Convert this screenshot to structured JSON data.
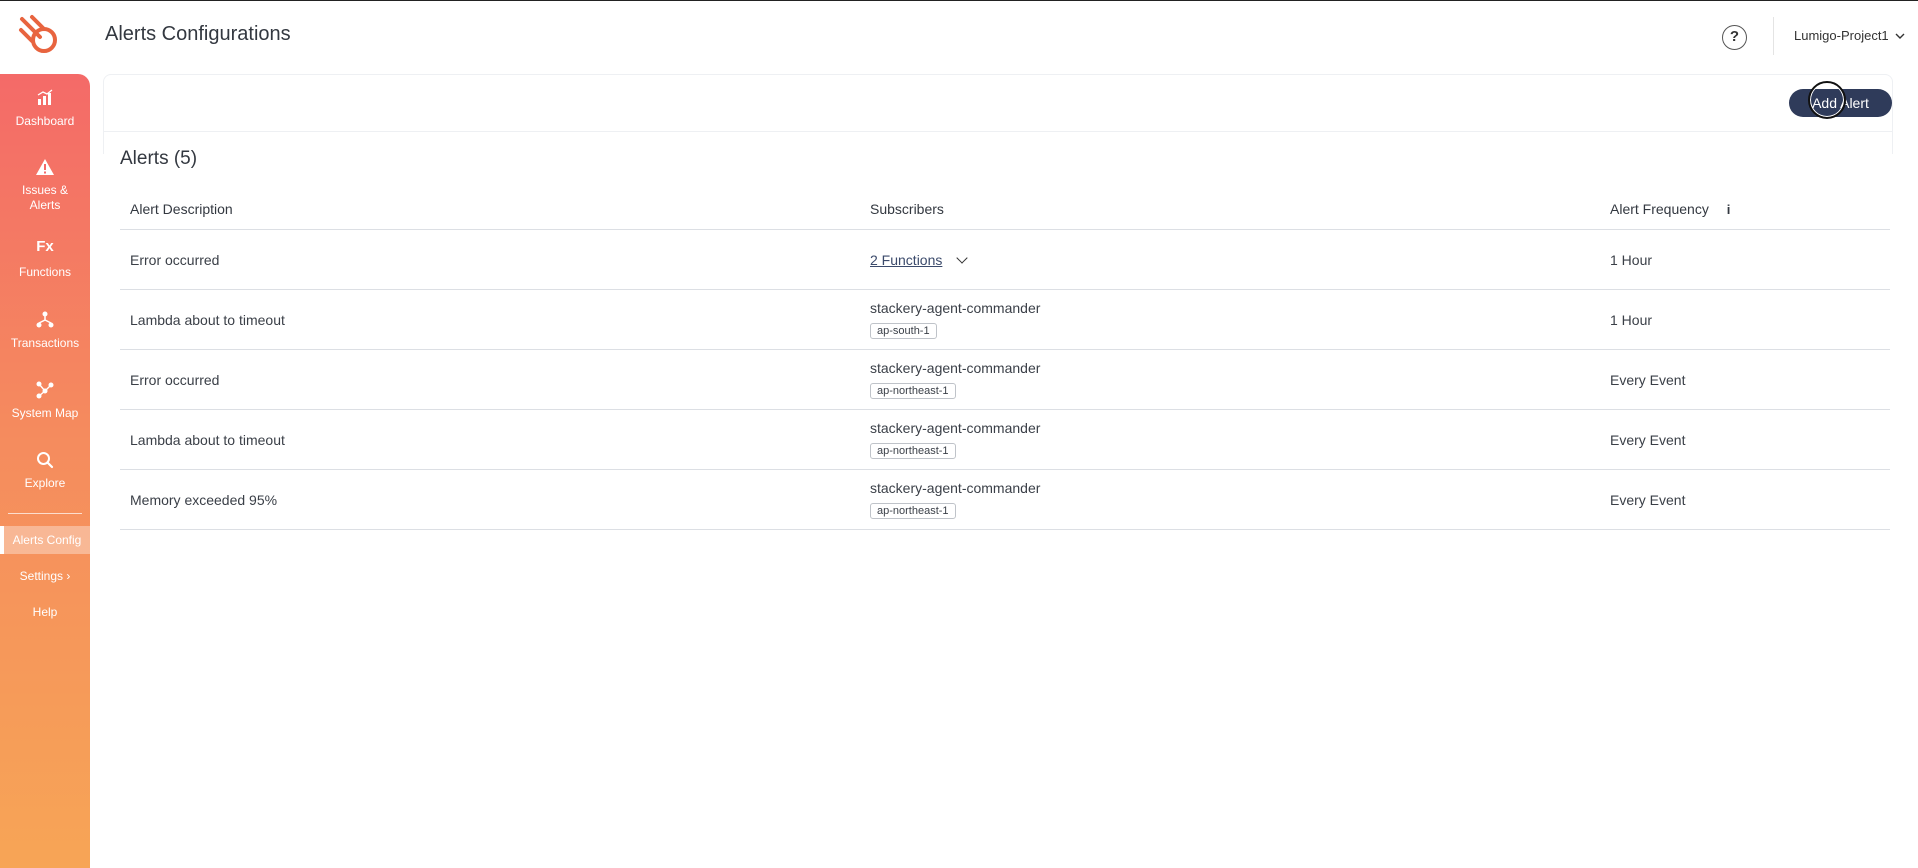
{
  "header": {
    "title": "Alerts Configurations",
    "help_label": "?",
    "project": "Lumigo-Project1",
    "logo_icon": "lumigo-logo-icon"
  },
  "sidebar": {
    "items": [
      {
        "label": "Dashboard",
        "icon": "bar-chart-icon"
      },
      {
        "label": "Issues & Alerts",
        "icon": "warning-triangle-icon"
      },
      {
        "label": "Functions",
        "icon": "fx-icon"
      },
      {
        "label": "Transactions",
        "icon": "tree-nodes-icon"
      },
      {
        "label": "System Map",
        "icon": "map-nodes-icon"
      },
      {
        "label": "Explore",
        "icon": "search-icon"
      }
    ],
    "links": [
      {
        "label": "Alerts Config",
        "active": true
      },
      {
        "label": "Settings",
        "chevron": "›"
      },
      {
        "label": "Help"
      }
    ],
    "fx_glyph": "Fx"
  },
  "toolbar": {
    "add_alert_label": "Add Alert"
  },
  "alerts": {
    "heading": "Alerts (5)",
    "columns": {
      "description": "Alert Description",
      "subscribers": "Subscribers",
      "frequency": "Alert Frequency",
      "frequency_info": "i"
    },
    "rows": [
      {
        "description": "Error occurred",
        "subscribers_link": "2 Functions",
        "frequency": "1 Hour"
      },
      {
        "description": "Lambda about to timeout",
        "subscriber": "stackery-agent-commander",
        "region": "ap-south-1",
        "frequency": "1 Hour"
      },
      {
        "description": "Error occurred",
        "subscriber": "stackery-agent-commander",
        "region": "ap-northeast-1",
        "frequency": "Every Event"
      },
      {
        "description": "Lambda about to timeout",
        "subscriber": "stackery-agent-commander",
        "region": "ap-northeast-1",
        "frequency": "Every Event"
      },
      {
        "description": "Memory exceeded 95%",
        "subscriber": "stackery-agent-commander",
        "region": "ap-northeast-1",
        "frequency": "Every Event"
      }
    ]
  },
  "colors": {
    "accent_dark": "#2f3b5a",
    "sidebar_top": "#f46a68",
    "sidebar_bottom": "#f7a556",
    "logo": "#e8643f"
  }
}
